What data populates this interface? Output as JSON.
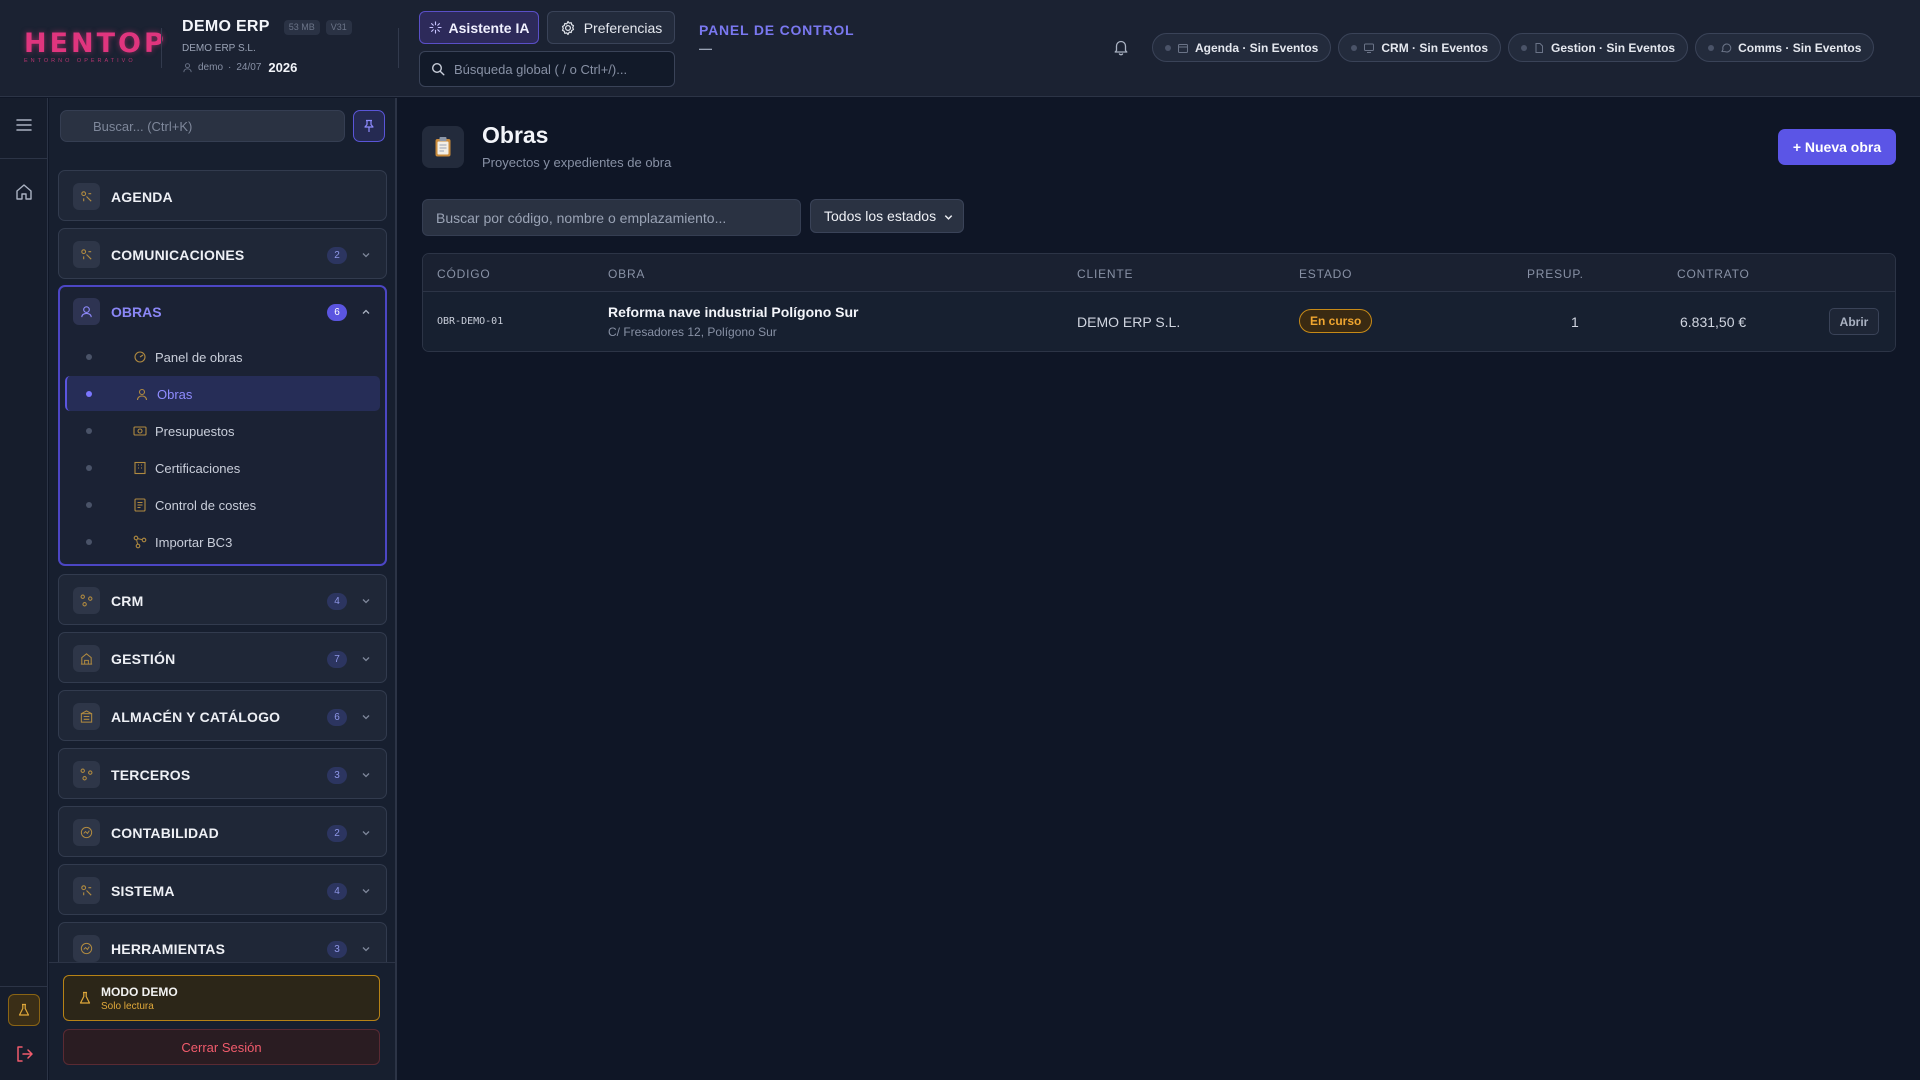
{
  "header": {
    "logo_text": "HENTOP",
    "logo_subtitle": "ENTORNO OPERATIVO",
    "company_name": "DEMO ERP",
    "size_tag": "53 MB",
    "version_tag": "V31",
    "company_legal": "DEMO ERP S.L.",
    "user": "demo",
    "date": "24/07",
    "year": "2026",
    "ai_button": "Asistente IA",
    "preferences_button": "Preferencias",
    "global_search_placeholder": "Búsqueda global ( / o Ctrl+/)...",
    "panel_title": "PANEL DE CONTROL",
    "panel_subtitle": "—",
    "status_pills": [
      {
        "label": "Agenda · Sin Eventos",
        "icon": "calendar-icon"
      },
      {
        "label": "CRM · Sin Eventos",
        "icon": "monitor-icon"
      },
      {
        "label": "Gestion · Sin Eventos",
        "icon": "document-icon"
      },
      {
        "label": "Comms · Sin Eventos",
        "icon": "chat-icon"
      }
    ]
  },
  "sidebar": {
    "search_placeholder": "Buscar... (Ctrl+K)",
    "sections": [
      {
        "label": "AGENDA",
        "badge": ""
      },
      {
        "label": "COMUNICACIONES",
        "badge": "2"
      },
      {
        "label": "OBRAS",
        "badge": "6"
      },
      {
        "label": "CRM",
        "badge": "4"
      },
      {
        "label": "GESTIÓN",
        "badge": "7"
      },
      {
        "label": "ALMACÉN Y CATÁLOGO",
        "badge": "6"
      },
      {
        "label": "TERCEROS",
        "badge": "3"
      },
      {
        "label": "CONTABILIDAD",
        "badge": "2"
      },
      {
        "label": "SISTEMA",
        "badge": "4"
      },
      {
        "label": "HERRAMIENTAS",
        "badge": "3"
      }
    ],
    "obras_items": [
      {
        "label": "Panel de obras"
      },
      {
        "label": "Obras"
      },
      {
        "label": "Presupuestos"
      },
      {
        "label": "Certificaciones"
      },
      {
        "label": "Control de costes"
      },
      {
        "label": "Importar BC3"
      }
    ],
    "demo_title": "MODO DEMO",
    "demo_subtitle": "Solo lectura",
    "logout_label": "Cerrar Sesión"
  },
  "main": {
    "title": "Obras",
    "subtitle": "Proyectos y expedientes de obra",
    "new_button": "+ Nueva obra",
    "filter_placeholder": "Buscar por código, nombre o emplazamiento...",
    "status_filter": "Todos los estados",
    "columns": [
      "CÓDIGO",
      "OBRA",
      "CLIENTE",
      "ESTADO",
      "PRESUP.",
      "CONTRATO"
    ],
    "rows": [
      {
        "code": "OBR-DEMO-01",
        "name": "Reforma nave industrial Polígono Sur",
        "address": "C/ Fresadores 12, Polígono Sur",
        "client": "DEMO ERP S.L.",
        "status": "En curso",
        "budgets": "1",
        "contract": "6.831,50 €",
        "action": "Abrir"
      }
    ]
  },
  "colors": {
    "accent": "#5b55e6",
    "brand": "#e0357e",
    "status_in_progress": "#f0a630",
    "danger": "#f15b6c"
  }
}
